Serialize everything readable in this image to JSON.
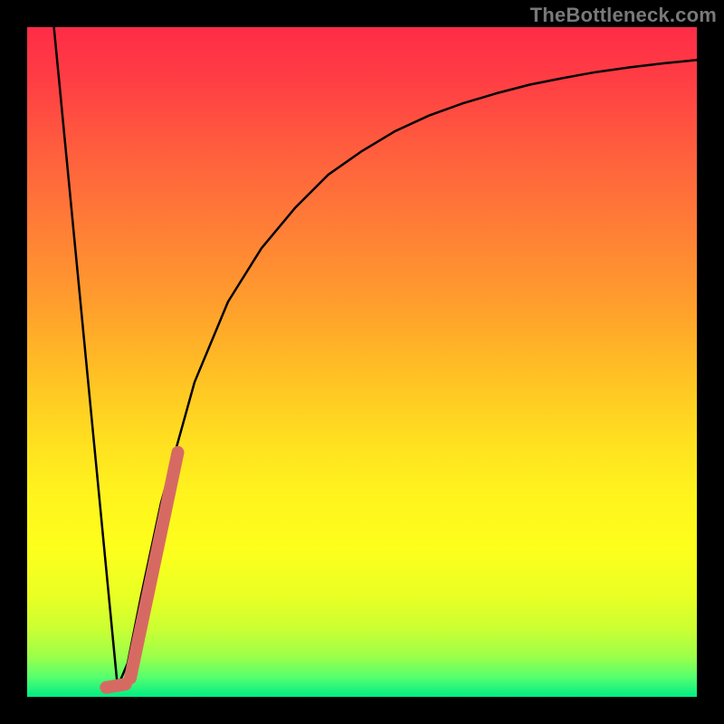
{
  "watermark": "TheBottleneck.com",
  "chart_data": {
    "type": "line",
    "title": "",
    "xlabel": "",
    "ylabel": "",
    "xlim": [
      0,
      100
    ],
    "ylim": [
      0,
      100
    ],
    "grid": false,
    "series": [
      {
        "name": "left-descending-branch",
        "x": [
          4,
          13.5
        ],
        "y": [
          100,
          1.5
        ],
        "style": "thin-black"
      },
      {
        "name": "right-ascending-curve",
        "x": [
          13.5,
          15,
          17,
          20,
          25,
          30,
          35,
          40,
          45,
          50,
          55,
          60,
          65,
          70,
          75,
          80,
          85,
          90,
          95,
          100
        ],
        "y": [
          1.5,
          5,
          15,
          29,
          47,
          59,
          67,
          73,
          78,
          81.5,
          84.5,
          86.8,
          88.6,
          90.1,
          91.4,
          92.4,
          93.3,
          94.0,
          94.6,
          95.1
        ],
        "style": "thin-black"
      },
      {
        "name": "highlight-segment",
        "x": [
          15.4,
          22.5
        ],
        "y": [
          2.8,
          36.5
        ],
        "style": "thick-salmon"
      },
      {
        "name": "highlight-min-marker",
        "x": [
          11.8,
          14.7
        ],
        "y": [
          1.4,
          1.9
        ],
        "style": "thick-salmon"
      }
    ],
    "colors": {
      "thin-black": "#000000",
      "thick-salmon": "#d66a63"
    }
  }
}
